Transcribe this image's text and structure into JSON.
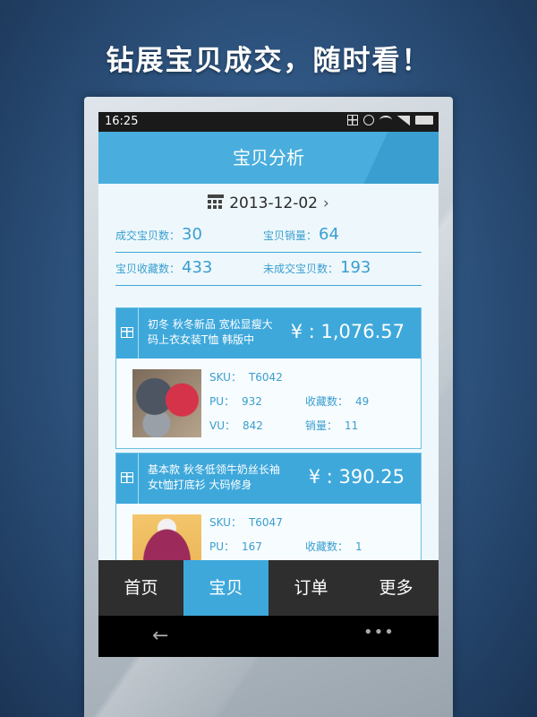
{
  "headline": "钻展宝贝成交，随时看！",
  "status": {
    "time": "16:25"
  },
  "title": "宝贝分析",
  "date": {
    "value": "2013-12-02",
    "next": "›"
  },
  "stats": [
    {
      "label": "成交宝贝数：",
      "value": "30"
    },
    {
      "label": "宝贝销量：",
      "value": "64"
    },
    {
      "label": "宝贝收藏数：",
      "value": "433"
    },
    {
      "label": "未成交宝贝数：",
      "value": "193"
    }
  ],
  "products": [
    {
      "title": "初冬 秋冬新品 宽松显瘦大码上衣女装T恤 韩版中",
      "price": "¥ : 1,076.57",
      "sku_label": "SKU：",
      "sku": "T6042",
      "pu_label": "PU：",
      "pu": "932",
      "fav_label": "收藏数：",
      "fav": "49",
      "vu_label": "VU：",
      "vu": "842",
      "sales_label": "销量：",
      "sales": "11"
    },
    {
      "title": "基本款 秋冬低领牛奶丝长袖女t恤打底衫 大码修身",
      "price": "¥ : 390.25",
      "sku_label": "SKU：",
      "sku": "T6047",
      "pu_label": "PU：",
      "pu": "167",
      "fav_label": "收藏数：",
      "fav": "1"
    }
  ],
  "nav": [
    "首页",
    "宝贝",
    "订单",
    "更多"
  ],
  "accent_color": "#3ea8db",
  "icons": [
    "calendar-icon",
    "gift-icon",
    "back-arrow-icon",
    "menu-dots-icon"
  ]
}
